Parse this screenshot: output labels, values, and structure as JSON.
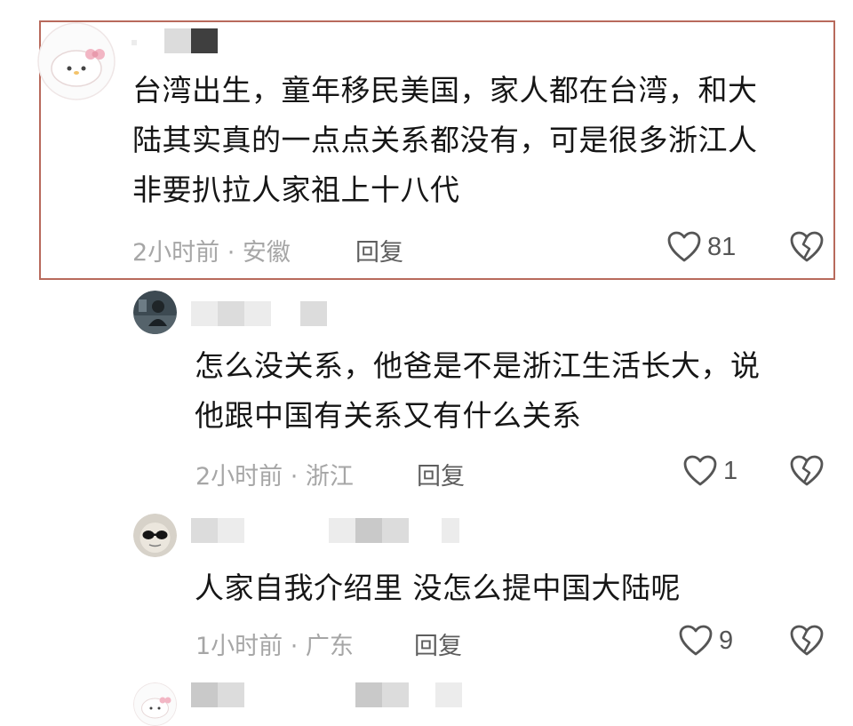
{
  "comments": [
    {
      "text_lines": [
        "台湾出生，童年移民美国，家人都在台湾，和大",
        "陆其实真的一点点关系都没有，可是很多浙江人",
        "非要扒拉人家祖上十八代"
      ],
      "meta": "2小时前 · 安徽",
      "reply_label": "回复",
      "likes": "81"
    },
    {
      "text_lines": [
        "怎么没关系，他爸是不是浙江生活长大，说",
        "他跟中国有关系又有什么关系"
      ],
      "meta": "2小时前 · 浙江",
      "reply_label": "回复",
      "likes": "1"
    },
    {
      "text_lines": [
        "人家自我介绍里 没怎么提中国大陆呢"
      ],
      "meta": "1小时前 · 广东",
      "reply_label": "回复",
      "likes": "9"
    }
  ],
  "icons": {
    "like": "heart-outline-icon",
    "dislike": "broken-heart-icon"
  },
  "colors": {
    "highlight_border": "#b86a5c",
    "meta_text": "#a6a6a6",
    "reply_text": "#5e5e5e"
  }
}
